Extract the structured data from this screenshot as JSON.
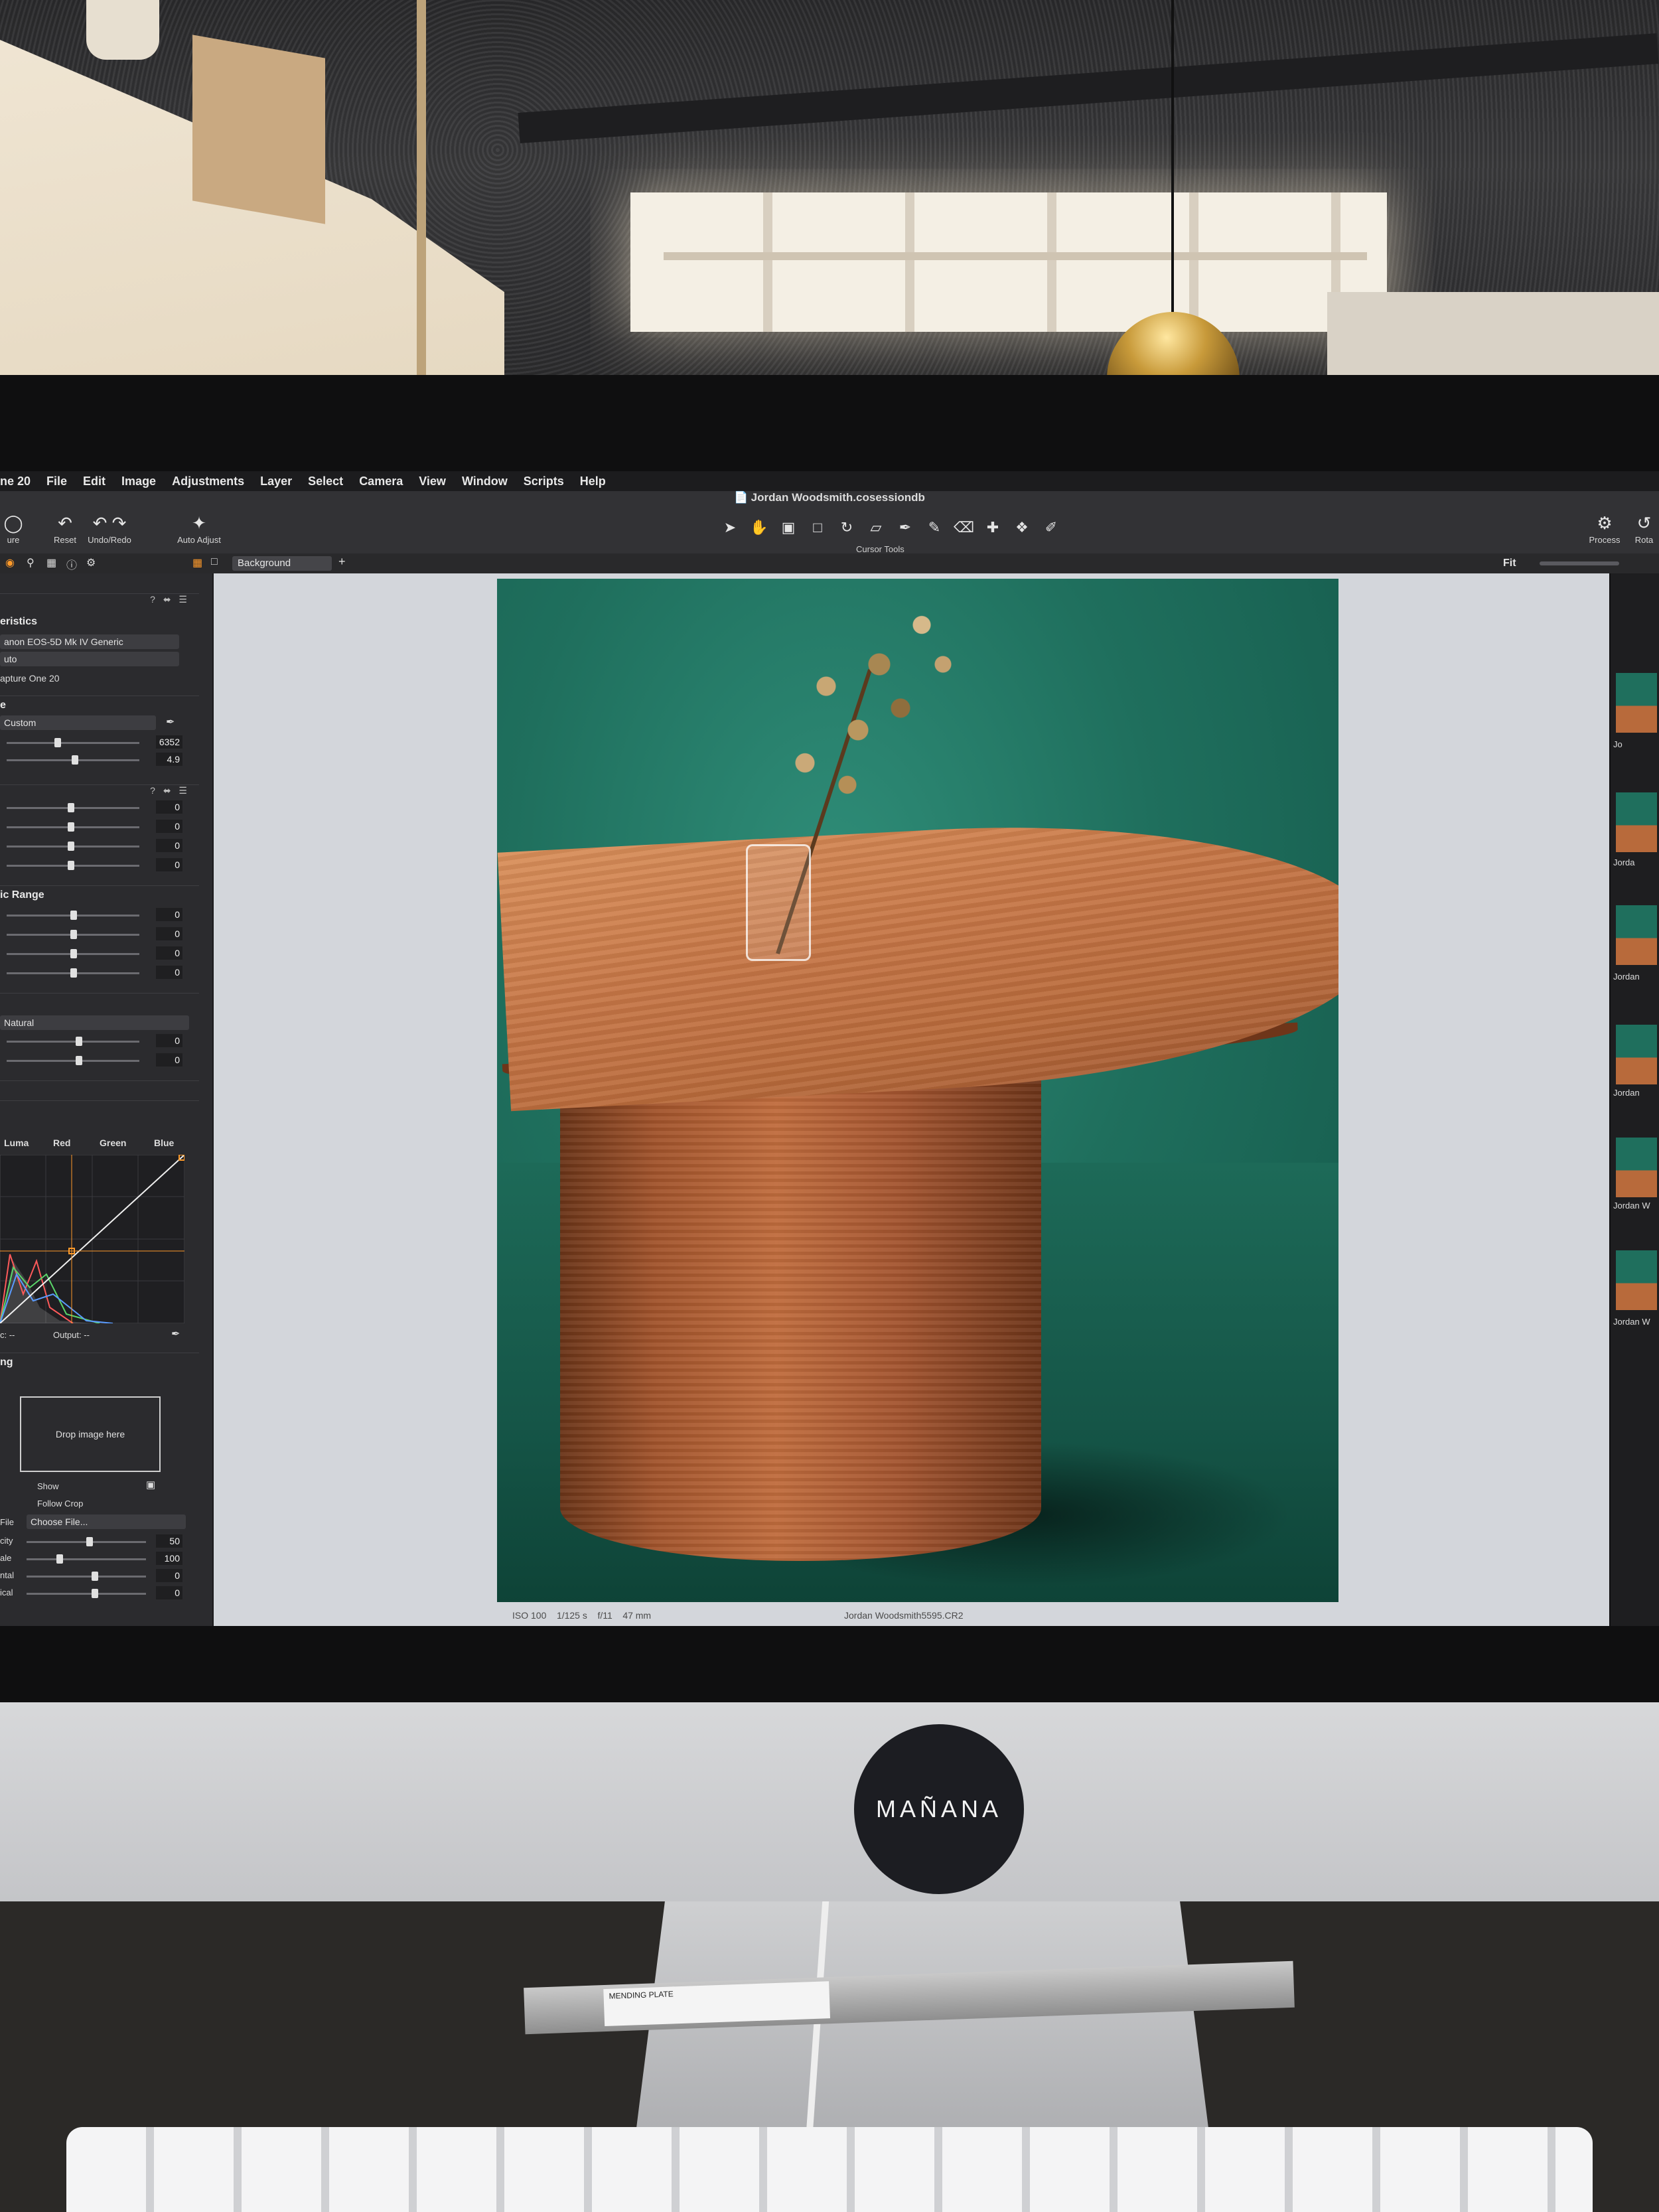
{
  "menubar": {
    "app": "ne 20",
    "items": [
      "File",
      "Edit",
      "Image",
      "Adjustments",
      "Layer",
      "Select",
      "Camera",
      "View",
      "Window",
      "Scripts",
      "Help"
    ]
  },
  "window": {
    "title": "Jordan Woodsmith.cosessiondb"
  },
  "toolbar": {
    "capture_label": "ure",
    "reset_label": "Reset",
    "undo_redo_label": "Undo/Redo",
    "auto_adjust_label": "Auto Adjust",
    "cursor_tools_label": "Cursor Tools",
    "process_label": "Process",
    "rotate_label": "Rota"
  },
  "subbar": {
    "layer_select": "Background",
    "zoom_label": "Fit"
  },
  "left_panel": {
    "characteristics": {
      "title": "eristics",
      "profile": "anon EOS-5D Mk IV Generic",
      "curve": "uto",
      "engine": "apture One 20"
    },
    "white_balance": {
      "title": "e",
      "mode": "Custom",
      "kelvin": "6352",
      "tint": "4.9"
    },
    "exposure_values": [
      "0",
      "0",
      "0",
      "0"
    ],
    "hdr": {
      "title": "ic Range",
      "values": [
        "0",
        "0",
        "0",
        "0"
      ]
    },
    "clarity": {
      "method": "Natural",
      "values": [
        "0",
        "0"
      ]
    },
    "curve_tabs": [
      "Luma",
      "Red",
      "Green",
      "Blue"
    ],
    "curve_io": {
      "input": "c: --",
      "output": "Output: --"
    },
    "overlay": {
      "title": "ng",
      "drop_text": "Drop image here",
      "show_label": "Show",
      "follow_crop_label": "Follow Crop",
      "file_label": "File",
      "file_select": "Choose File...",
      "rows": [
        {
          "label": "city",
          "value": "50"
        },
        {
          "label": "ale",
          "value": "100"
        },
        {
          "label": "ntal",
          "value": "0"
        },
        {
          "label": "ical",
          "value": "0"
        }
      ]
    }
  },
  "viewer": {
    "meta": {
      "iso": "ISO 100",
      "shutter": "1/125 s",
      "aperture": "f/11",
      "focal": "47 mm"
    },
    "filename": "Jordan Woodsmith5595.CR2"
  },
  "filmstrip": {
    "labels": [
      "Jo",
      "Jorda",
      "Jordan",
      "Jordan",
      "Jordan W",
      "Jordan W"
    ]
  },
  "monitor": {
    "brand_sticker": "MAÑANA"
  },
  "desk": {
    "plate_label": "MENDING PLATE"
  },
  "colors": {
    "accent": "#ff9a2a",
    "backdrop": "#1f6f5d",
    "wood": "#c06c3d"
  }
}
